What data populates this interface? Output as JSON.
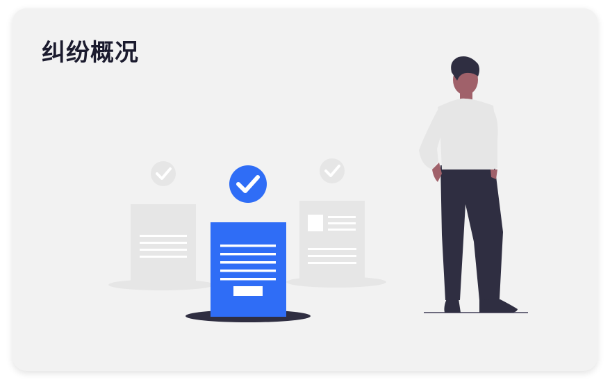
{
  "card": {
    "title": "纠纷概况"
  },
  "illustration": {
    "items": [
      {
        "name": "left-document",
        "status": "verified",
        "style": "faded"
      },
      {
        "name": "center-document",
        "status": "verified",
        "style": "highlighted"
      },
      {
        "name": "right-document",
        "status": "verified",
        "style": "faded"
      }
    ],
    "figure": "standing-person"
  },
  "colors": {
    "card_bg": "#f2f2f2",
    "title_text": "#1b1b2e",
    "accent": "#2f6df6",
    "faded_doc": "#e6e6e6",
    "shadow": "#2f2e41"
  }
}
